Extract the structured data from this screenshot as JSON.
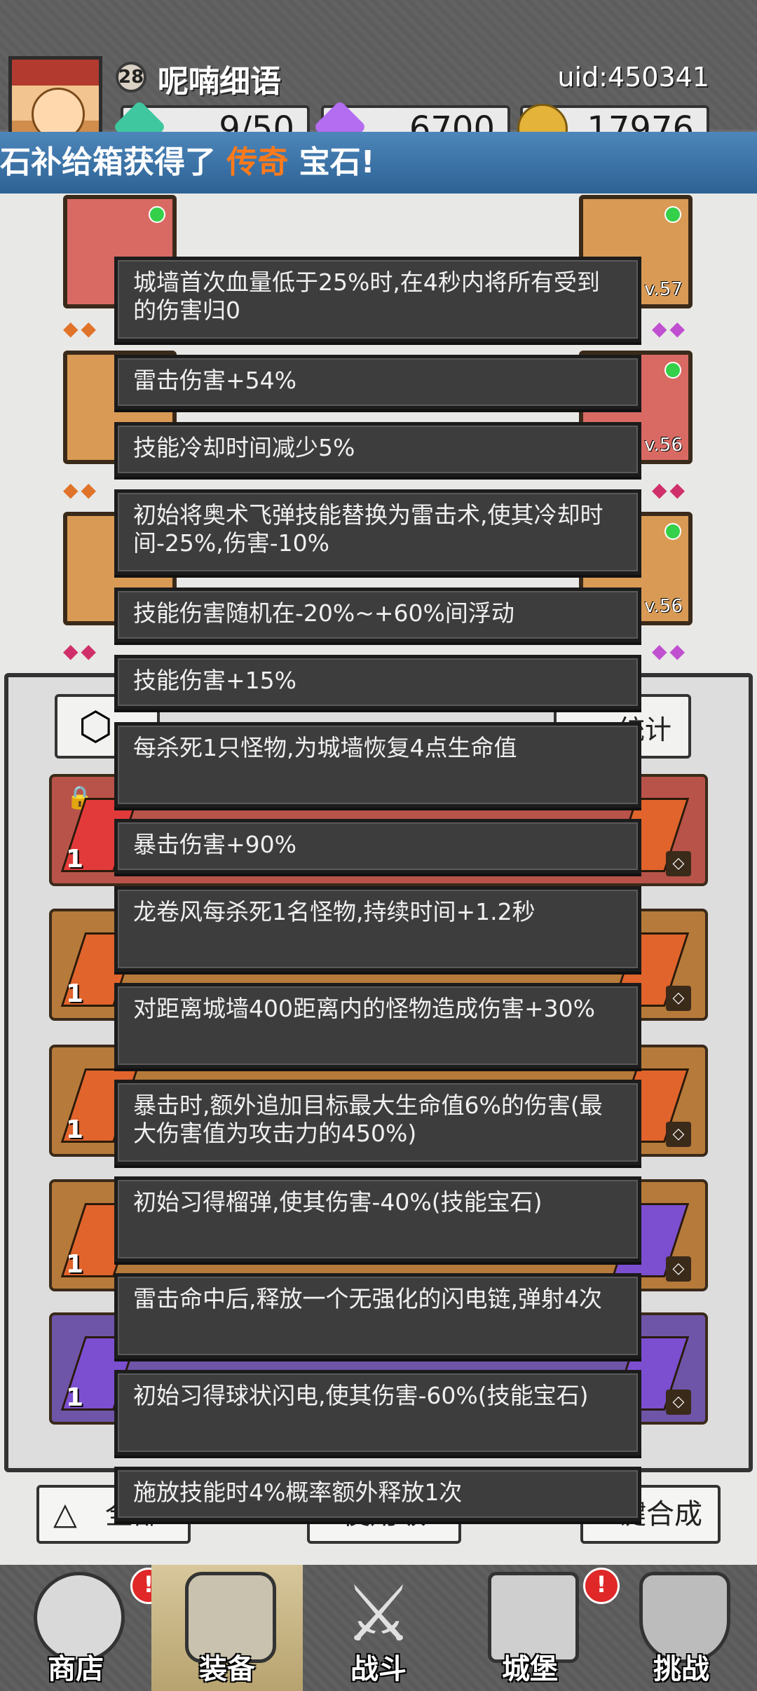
{
  "header": {
    "player_level": "28",
    "player_name": "呢喃细语",
    "uid": "uid:450341",
    "currencies": [
      {
        "icon": "energy-crystal-icon",
        "value": "9/50",
        "color": "#3fc7a0"
      },
      {
        "icon": "purple-gem-icon",
        "value": "6700",
        "color": "#b46df0"
      },
      {
        "icon": "gold-coin-icon",
        "value": "17976",
        "color": "#e3b33a"
      }
    ]
  },
  "ticker": {
    "prefix": "石补给箱获得了",
    "highlight": "传奇",
    "suffix": "宝石!"
  },
  "gear_levels": {
    "right_1": "v.57",
    "right_2": "v.56",
    "right_3": "v.56"
  },
  "inventory": {
    "left_counts": [
      "1",
      "1",
      "1",
      "1",
      "1"
    ],
    "tab_right_label": "统计"
  },
  "bottom_buttons": {
    "all_label": "全部",
    "middle_label": "使用级",
    "right_label": "键合成"
  },
  "tooltips": [
    "城墙首次血量低于25%时,在4秒内将所有受到的伤害归0",
    "雷击伤害+54%",
    "技能冷却时间减少5%",
    "初始将奥术飞弹技能替换为雷击术,使其冷却时间-25%,伤害-10%",
    "技能伤害随机在-20%~+60%间浮动",
    "技能伤害+15%",
    "每杀死1只怪物,为城墙恢复4点生命值",
    "暴击伤害+90%",
    "龙卷风每杀死1名怪物,持续时间+1.2秒",
    "对距离城墙400距离内的怪物造成伤害+30%",
    "暴击时,额外追加目标最大生命值6%的伤害(最大伤害值为攻击力的450%)",
    "初始习得榴弹,使其伤害-40%(技能宝石)",
    "雷击命中后,释放一个无强化的闪电链,弹射4次",
    "初始习得球状闪电,使其伤害-60%(技能宝石)",
    "施放技能时4%概率额外释放1次"
  ],
  "nav": [
    {
      "label": "商店",
      "icon": "shop-icon",
      "alert": "!"
    },
    {
      "label": "装备",
      "icon": "backpack-icon",
      "alert": ""
    },
    {
      "label": "战斗",
      "icon": "crossed-swords-icon",
      "alert": ""
    },
    {
      "label": "城堡",
      "icon": "castle-icon",
      "alert": "!"
    },
    {
      "label": "挑战",
      "icon": "shield-icon",
      "alert": ""
    }
  ]
}
